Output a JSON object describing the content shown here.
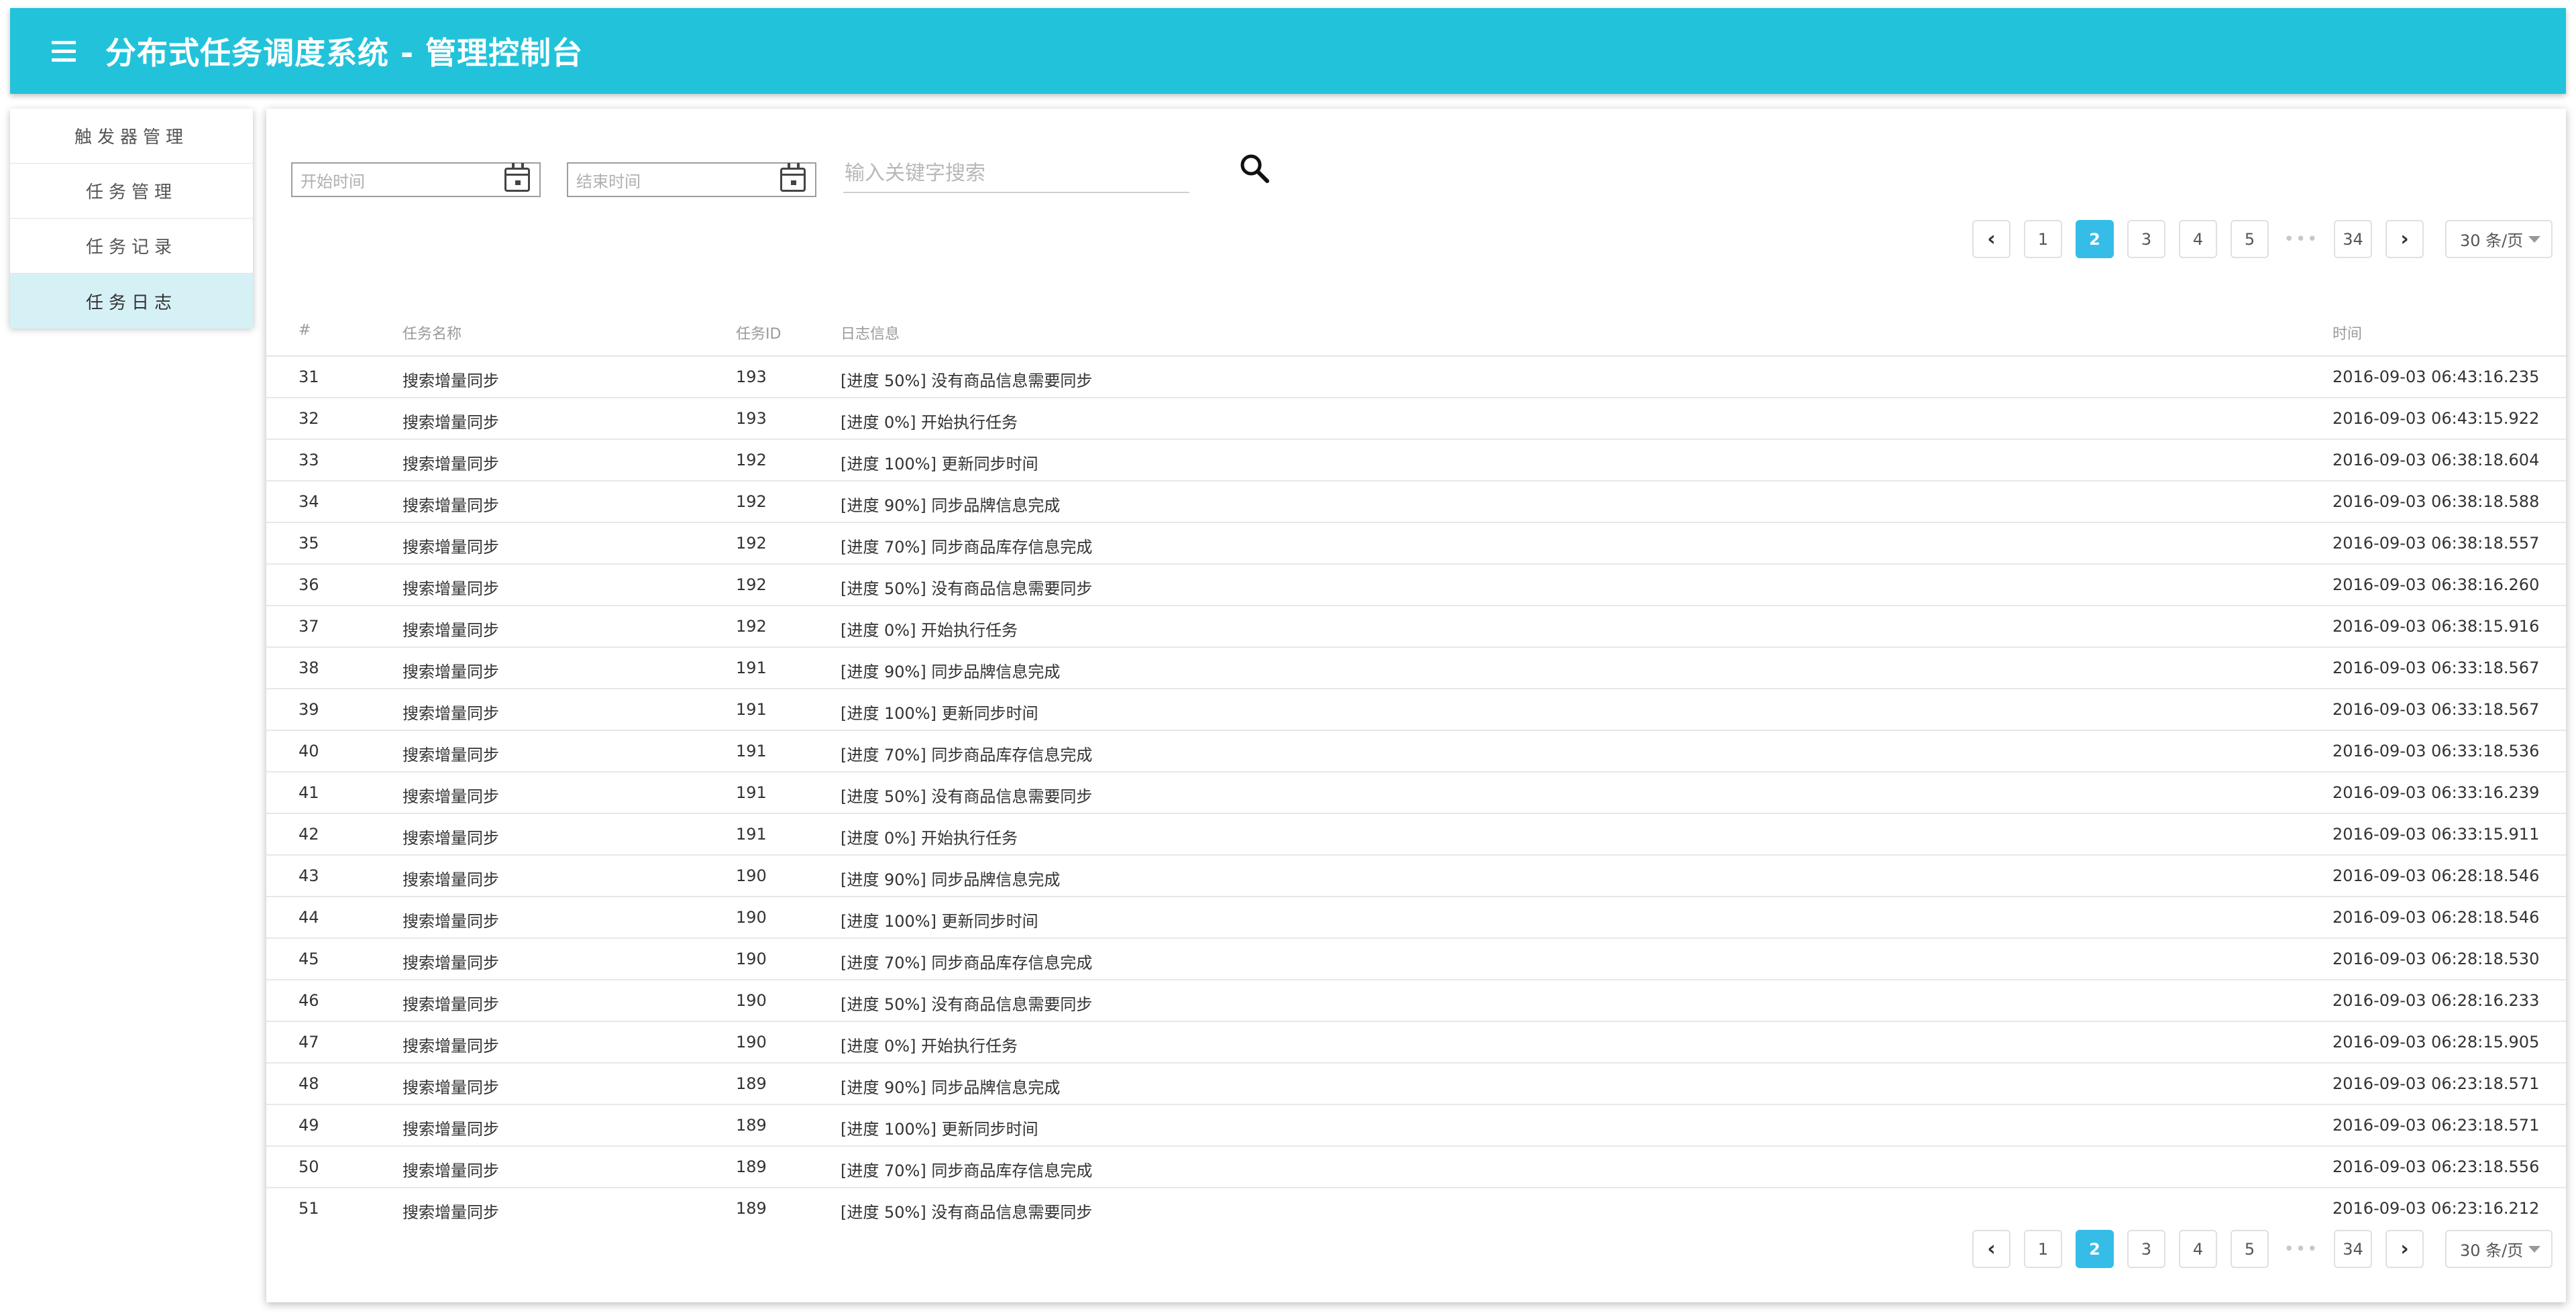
{
  "header": {
    "title": "分布式任务调度系统 - 管理控制台"
  },
  "sidebar": {
    "items": [
      {
        "label": "触发器管理"
      },
      {
        "label": "任务管理"
      },
      {
        "label": "任务记录"
      },
      {
        "label": "任务日志",
        "active": true
      }
    ]
  },
  "filters": {
    "start_placeholder": "开始时间",
    "end_placeholder": "结束时间",
    "search_placeholder": "输入关键字搜索"
  },
  "pagination": {
    "prev_icon": "chevron-left-icon",
    "next_icon": "chevron-right-icon",
    "pages": [
      "1",
      "2",
      "3",
      "4",
      "5"
    ],
    "current": "2",
    "ellipsis": "•••",
    "last": "34",
    "per_page": "30 条/页"
  },
  "table": {
    "columns": [
      "#",
      "任务名称",
      "任务ID",
      "日志信息",
      "时间"
    ],
    "rows": [
      {
        "idx": "31",
        "name": "搜索增量同步",
        "id": "193",
        "log": "[进度 50%] 没有商品信息需要同步",
        "time": "2016-09-03 06:43:16.235"
      },
      {
        "idx": "32",
        "name": "搜索增量同步",
        "id": "193",
        "log": "[进度 0%] 开始执行任务",
        "time": "2016-09-03 06:43:15.922"
      },
      {
        "idx": "33",
        "name": "搜索增量同步",
        "id": "192",
        "log": "[进度 100%] 更新同步时间",
        "time": "2016-09-03 06:38:18.604"
      },
      {
        "idx": "34",
        "name": "搜索增量同步",
        "id": "192",
        "log": "[进度 90%] 同步品牌信息完成",
        "time": "2016-09-03 06:38:18.588"
      },
      {
        "idx": "35",
        "name": "搜索增量同步",
        "id": "192",
        "log": "[进度 70%] 同步商品库存信息完成",
        "time": "2016-09-03 06:38:18.557"
      },
      {
        "idx": "36",
        "name": "搜索增量同步",
        "id": "192",
        "log": "[进度 50%] 没有商品信息需要同步",
        "time": "2016-09-03 06:38:16.260"
      },
      {
        "idx": "37",
        "name": "搜索增量同步",
        "id": "192",
        "log": "[进度 0%] 开始执行任务",
        "time": "2016-09-03 06:38:15.916"
      },
      {
        "idx": "38",
        "name": "搜索增量同步",
        "id": "191",
        "log": "[进度 90%] 同步品牌信息完成",
        "time": "2016-09-03 06:33:18.567"
      },
      {
        "idx": "39",
        "name": "搜索增量同步",
        "id": "191",
        "log": "[进度 100%] 更新同步时间",
        "time": "2016-09-03 06:33:18.567"
      },
      {
        "idx": "40",
        "name": "搜索增量同步",
        "id": "191",
        "log": "[进度 70%] 同步商品库存信息完成",
        "time": "2016-09-03 06:33:18.536"
      },
      {
        "idx": "41",
        "name": "搜索增量同步",
        "id": "191",
        "log": "[进度 50%] 没有商品信息需要同步",
        "time": "2016-09-03 06:33:16.239"
      },
      {
        "idx": "42",
        "name": "搜索增量同步",
        "id": "191",
        "log": "[进度 0%] 开始执行任务",
        "time": "2016-09-03 06:33:15.911"
      },
      {
        "idx": "43",
        "name": "搜索增量同步",
        "id": "190",
        "log": "[进度 90%] 同步品牌信息完成",
        "time": "2016-09-03 06:28:18.546"
      },
      {
        "idx": "44",
        "name": "搜索增量同步",
        "id": "190",
        "log": "[进度 100%] 更新同步时间",
        "time": "2016-09-03 06:28:18.546"
      },
      {
        "idx": "45",
        "name": "搜索增量同步",
        "id": "190",
        "log": "[进度 70%] 同步商品库存信息完成",
        "time": "2016-09-03 06:28:18.530"
      },
      {
        "idx": "46",
        "name": "搜索增量同步",
        "id": "190",
        "log": "[进度 50%] 没有商品信息需要同步",
        "time": "2016-09-03 06:28:16.233"
      },
      {
        "idx": "47",
        "name": "搜索增量同步",
        "id": "190",
        "log": "[进度 0%] 开始执行任务",
        "time": "2016-09-03 06:28:15.905"
      },
      {
        "idx": "48",
        "name": "搜索增量同步",
        "id": "189",
        "log": "[进度 90%] 同步品牌信息完成",
        "time": "2016-09-03 06:23:18.571"
      },
      {
        "idx": "49",
        "name": "搜索增量同步",
        "id": "189",
        "log": "[进度 100%] 更新同步时间",
        "time": "2016-09-03 06:23:18.571"
      },
      {
        "idx": "50",
        "name": "搜索增量同步",
        "id": "189",
        "log": "[进度 70%] 同步商品库存信息完成",
        "time": "2016-09-03 06:23:18.556"
      },
      {
        "idx": "51",
        "name": "搜索增量同步",
        "id": "189",
        "log": "[进度 50%] 没有商品信息需要同步",
        "time": "2016-09-03 06:23:16.212"
      }
    ]
  },
  "colors": {
    "header_bg": "#22c3da",
    "active_sidebar_bg": "#d6f1f6",
    "active_page_bg": "#35bde8"
  },
  "icons": {
    "menu": "hamburger-menu-icon",
    "calendar": "calendar-icon",
    "search": "search-icon"
  }
}
